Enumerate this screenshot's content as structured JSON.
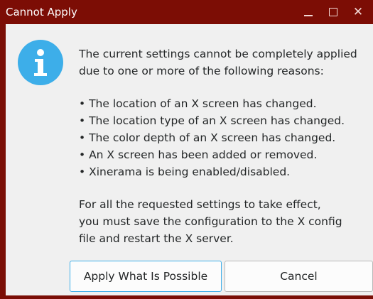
{
  "window": {
    "title": "Cannot Apply",
    "controls": {
      "minimize": "minimize-icon",
      "maximize": "maximize-icon",
      "close_glyph": "✕"
    },
    "titlebar_color": "#7c0d05"
  },
  "dialog": {
    "icon": "info-icon",
    "icon_color": "#3daee9",
    "intro_lines": [
      "The current settings cannot be completely applied",
      "due to one or more of the following reasons:"
    ],
    "reasons": [
      "• The location of an X screen has changed.",
      "• The location type of an X screen has changed.",
      "• The color depth of an X screen has changed.",
      "• An X screen has been added or removed.",
      "• Xinerama is being enabled/disabled."
    ],
    "footer_lines": [
      "For all the requested settings to take effect,",
      "you must save the configuration to the X config",
      "file and restart the X server."
    ]
  },
  "buttons": {
    "apply_label": "Apply What Is Possible",
    "cancel_label": "Cancel"
  }
}
